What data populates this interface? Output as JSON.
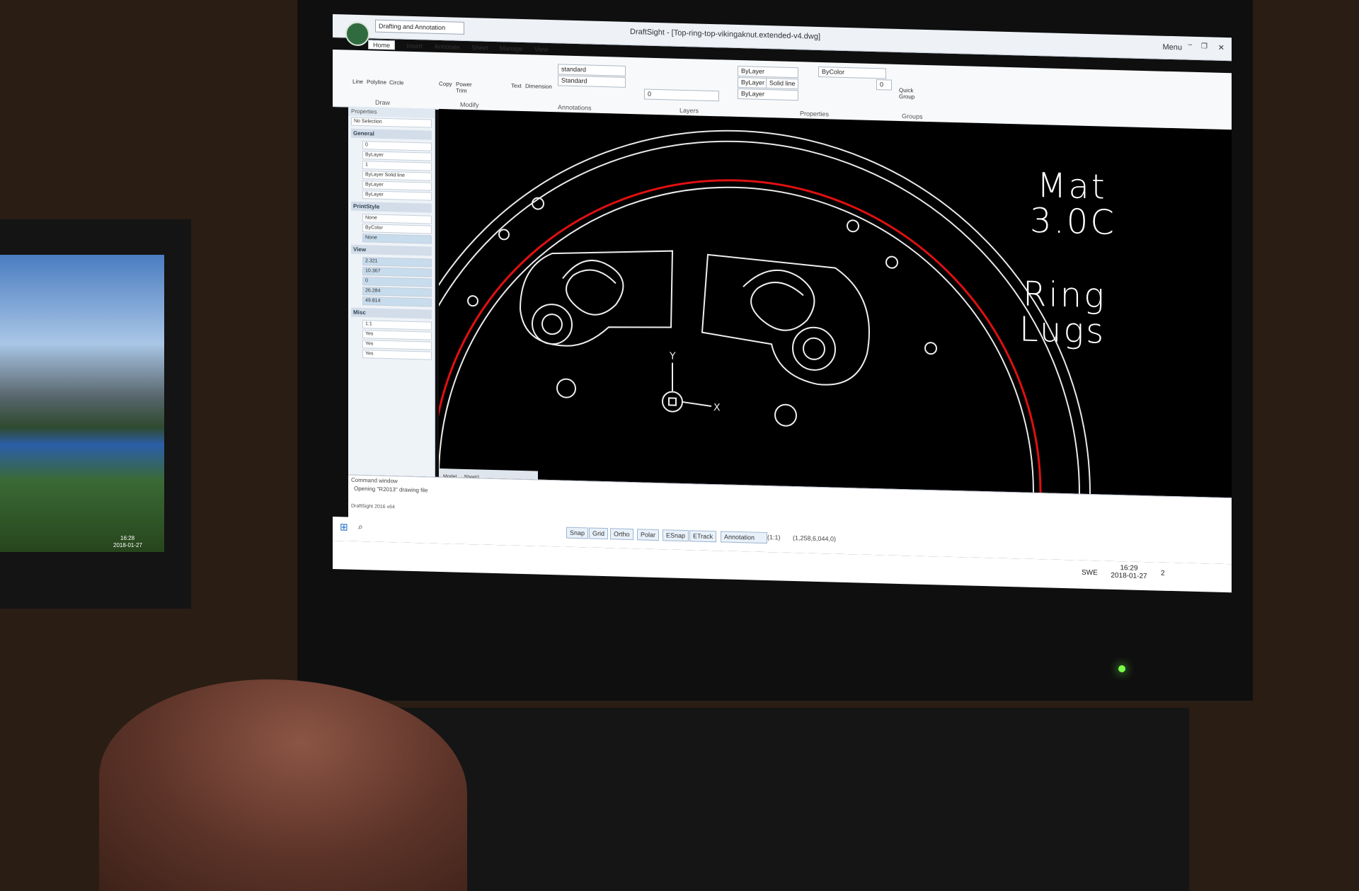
{
  "app": {
    "window_title": "DraftSight - [Top-ring-top-vikingaknut.extended-v4.dwg]",
    "menu_label": "Menu",
    "workspace": "Drafting and Annotation",
    "tabs": [
      "Home",
      "Insert",
      "Annotate",
      "Sheet",
      "Manage",
      "View"
    ]
  },
  "ribbon": {
    "draw": {
      "group": "Draw",
      "tools": [
        "Line",
        "Polyline",
        "Circle"
      ]
    },
    "modify": {
      "group": "Modify",
      "tools": [
        "Copy",
        "Power Trim"
      ]
    },
    "annotations": {
      "group": "Annotations",
      "tools": [
        "Text",
        "Dimension"
      ],
      "style1": "standard",
      "style2": "Standard"
    },
    "layers": {
      "group": "Layers",
      "layer_value": "0"
    },
    "properties": {
      "group": "Properties",
      "color": "ByLayer",
      "linetype": "ByLayer",
      "linestyle": "Solid line",
      "lineweight": "ByLayer",
      "color2": "ByColor",
      "number": "0"
    },
    "groups": {
      "group": "Groups",
      "tool": "Quick Group"
    }
  },
  "properties_panel": {
    "title": "Properties",
    "selection": "No Selection",
    "general": {
      "label": "General",
      "layer": "0",
      "color": "ByLayer",
      "scale": "1",
      "linestyle_a": "ByLayer",
      "linestyle_b": "Solid line",
      "lineweight": "ByLayer",
      "extra": "ByLayer"
    },
    "printstyle": {
      "label": "PrintStyle",
      "v1": "None",
      "v2": "ByColor",
      "v3": "None"
    },
    "view": {
      "label": "View",
      "values": [
        "2.321",
        "10.367",
        "0",
        "26.284",
        "49.814"
      ]
    },
    "misc": {
      "label": "Misc",
      "values": [
        "1:1",
        "Yes",
        "Yes",
        "Yes"
      ]
    }
  },
  "canvas": {
    "text_line1": "Mat",
    "text_line2": "3.0C",
    "text_line3": "Ring",
    "text_line4": "Lugs",
    "axis_y": "Y",
    "axis_x": "X",
    "sheet_tabs": [
      "Model",
      "Sheet1"
    ]
  },
  "command": {
    "label": "Command window",
    "message": "Opening \"R2013\" drawing file",
    "version": "DraftSight 2016 x64"
  },
  "status": {
    "buttons": [
      "Snap",
      "Grid",
      "Ortho",
      "Polar",
      "ESnap",
      "ETrack"
    ],
    "annotation": "Annotation",
    "scale": "(1:1)",
    "coords": "(1,258,6,044,0)"
  },
  "tray": {
    "lang": "SWE",
    "time": "16:29",
    "date": "2018-01-27",
    "notif": "2"
  },
  "laptop": {
    "time": "16:28",
    "date": "2018-01-27"
  },
  "colors": {
    "canvas_bg": "#000000",
    "red_circle": "#e01010",
    "ui_bg": "#f7f9fb"
  }
}
